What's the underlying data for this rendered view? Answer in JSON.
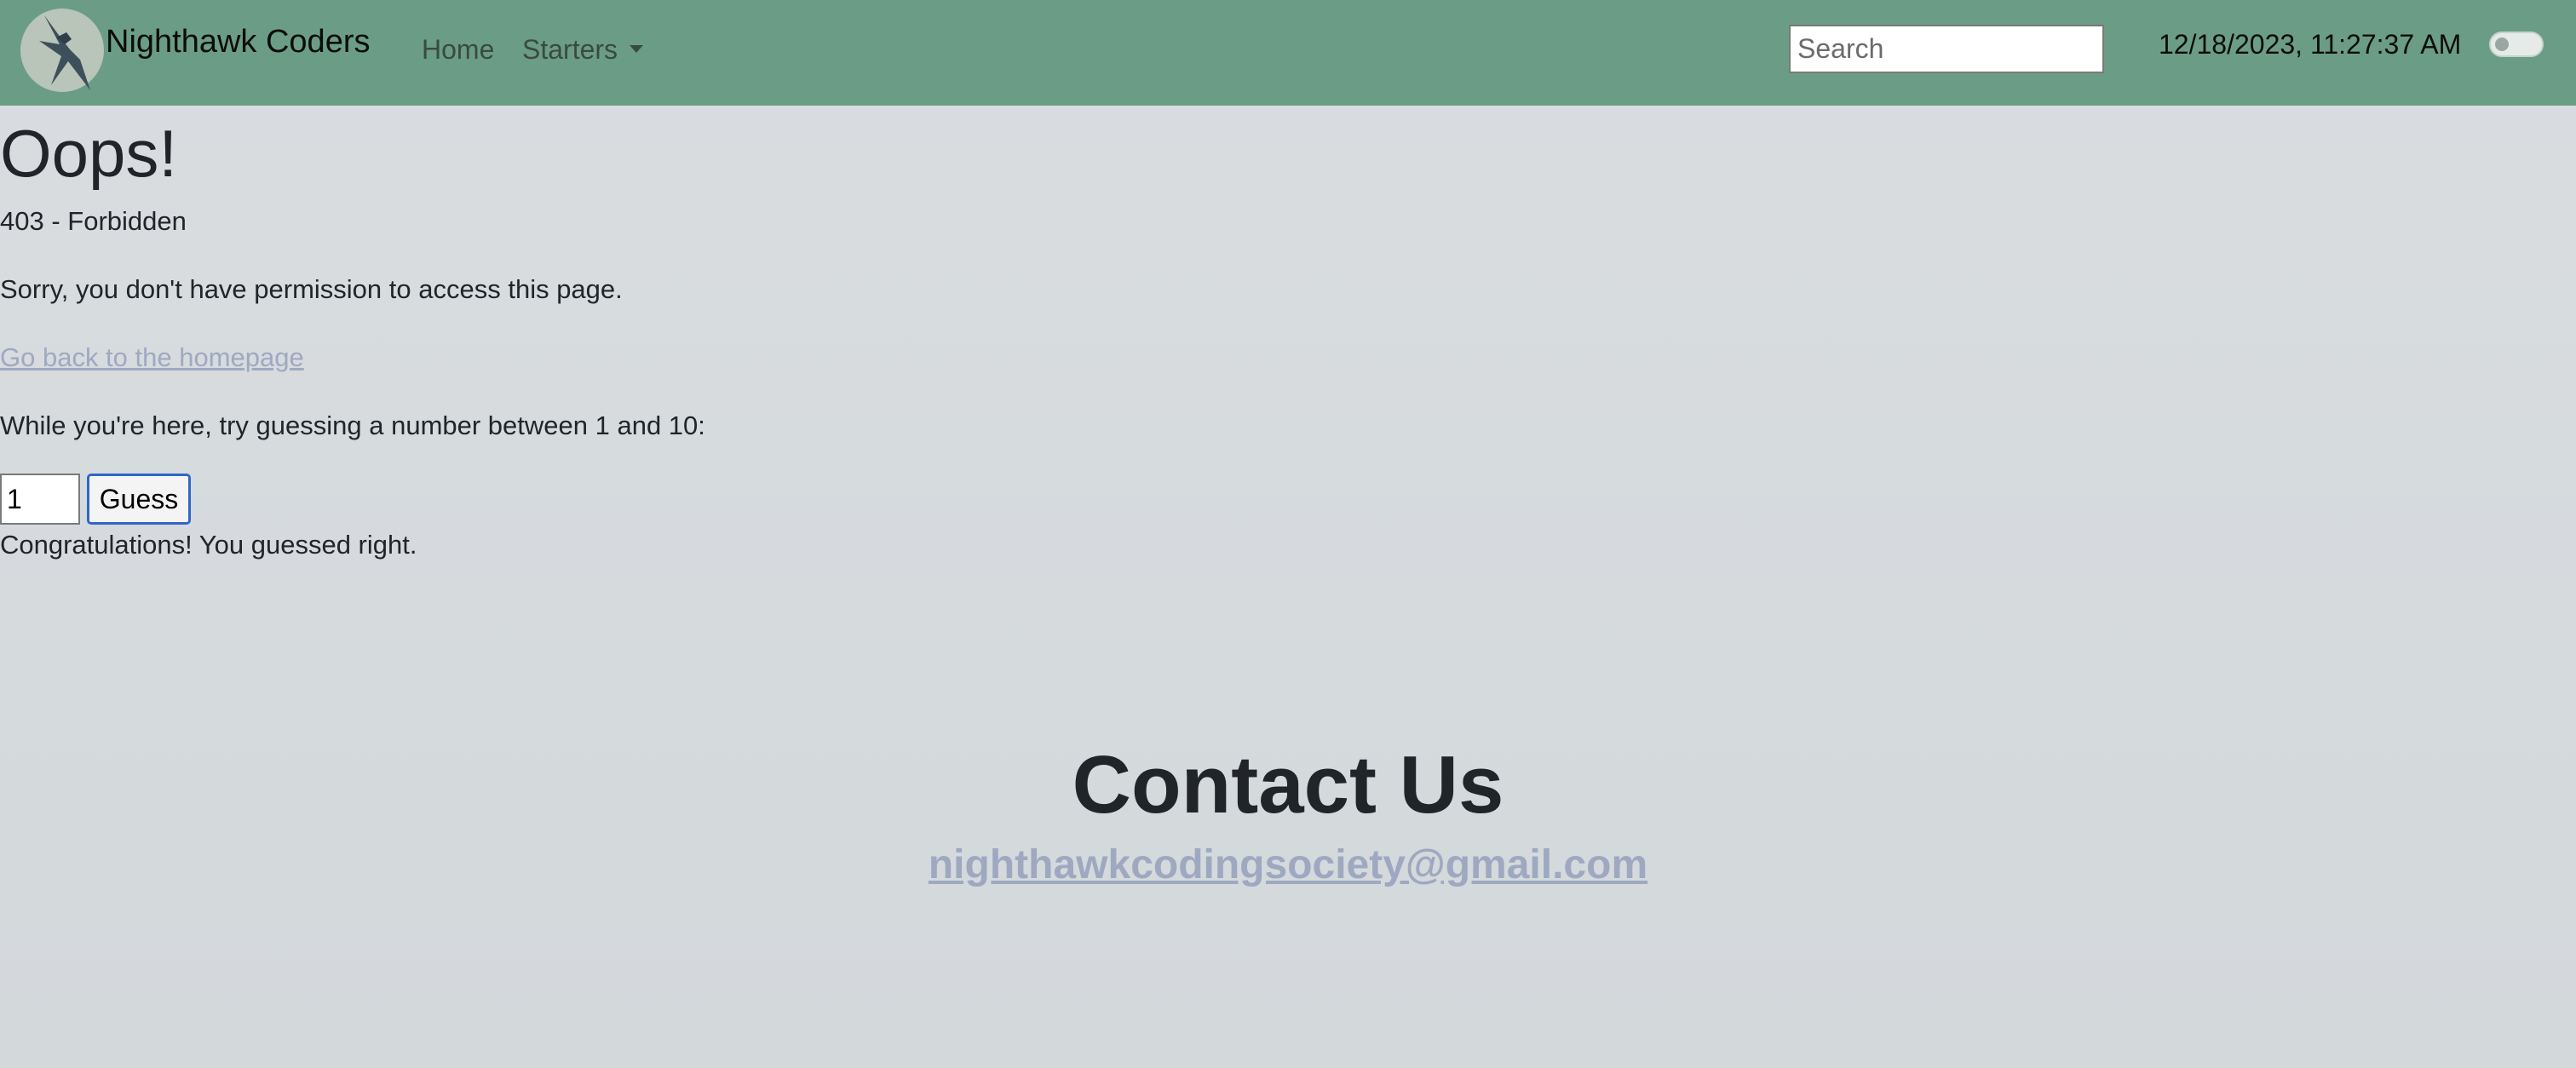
{
  "navbar": {
    "brand_name": "Nighthawk Coders",
    "logo_icon": "nighthawk-logo-icon",
    "links": [
      {
        "label": "Home"
      },
      {
        "label": "Starters"
      }
    ],
    "starters_caret_icon": "caret-down-icon",
    "search_placeholder": "Search",
    "clock_text": "12/18/2023, 11:27:37 AM",
    "theme_toggle": "off"
  },
  "main": {
    "heading": "Oops!",
    "error_code": "403 - Forbidden",
    "message": "Sorry, you don't have permission to access this page.",
    "back_link": "Go back to the homepage",
    "guess_prompt": "While you're here, try guessing a number between 1 and 10:",
    "guess_value": "1",
    "guess_button": "Guess",
    "result": "Congratulations! You guessed right."
  },
  "contact": {
    "title": "Contact Us",
    "email": "nighthawkcodingsociety@gmail.com"
  },
  "colors": {
    "navbar_bg": "#6b9d86",
    "page_bg": "#d6dadd",
    "link": "#9ea9c1",
    "button_border": "#2e67c7"
  }
}
